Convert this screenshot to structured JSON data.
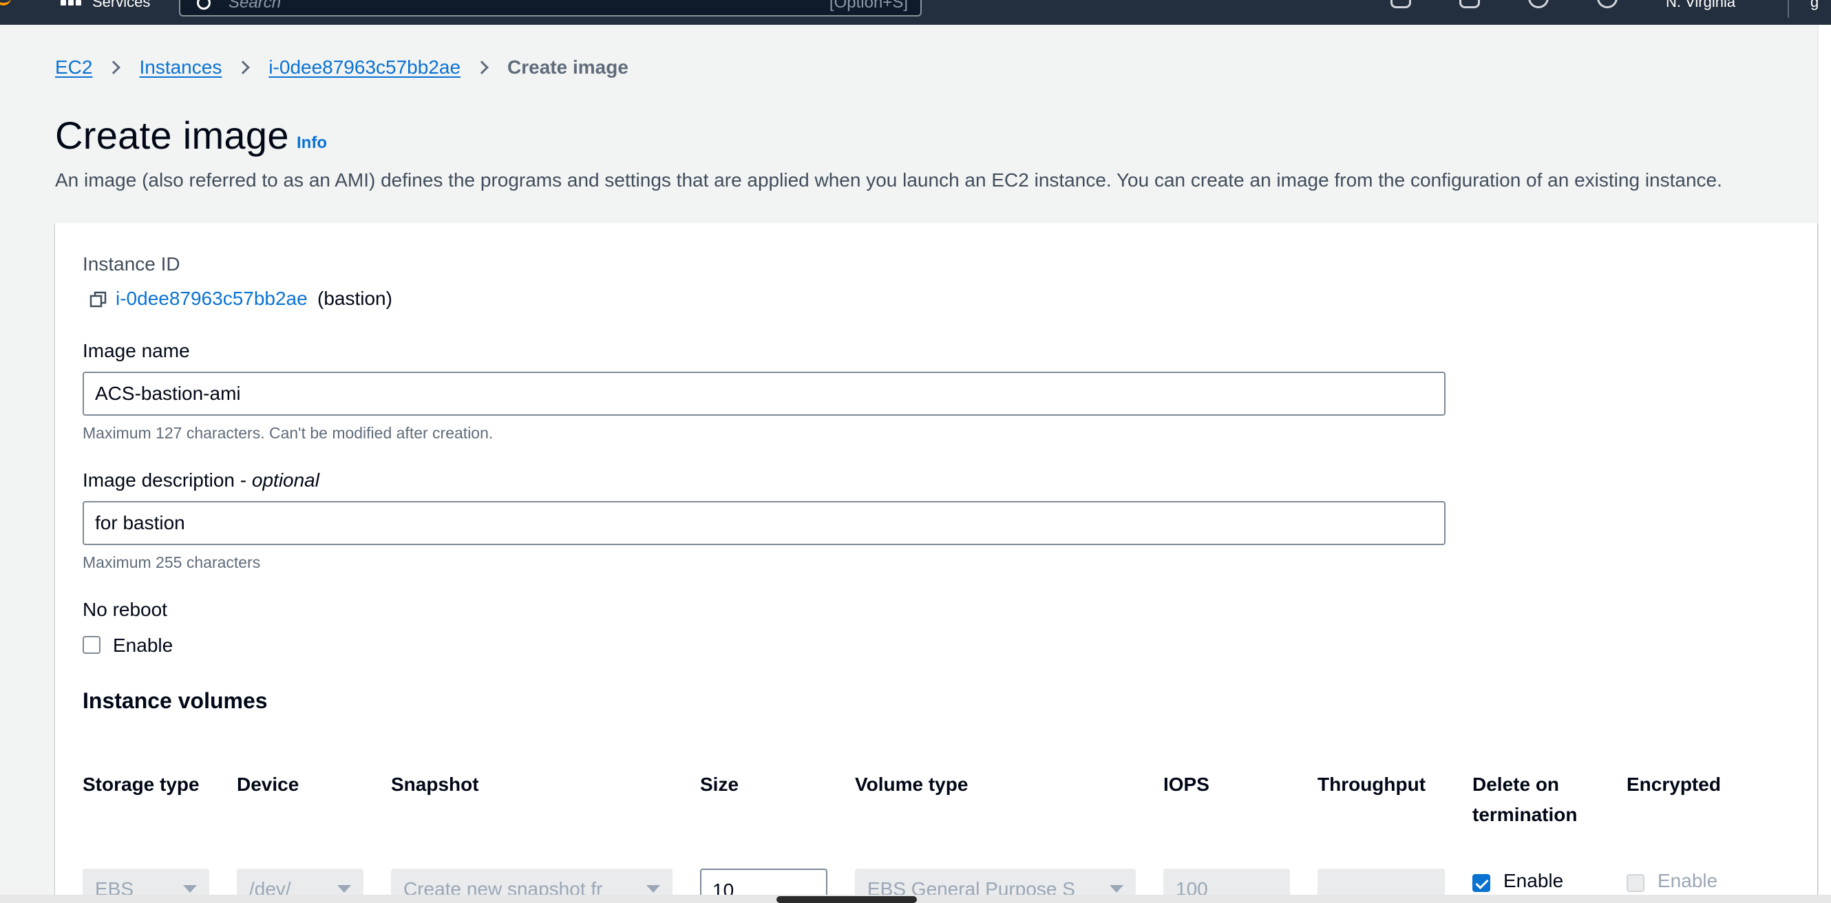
{
  "topnav": {
    "services_label": "Services",
    "search_placeholder": "Search",
    "search_shortcut": "[Option+S]",
    "region": "N. Virginia",
    "account_fragment": "g"
  },
  "breadcrumb": {
    "items": [
      "EC2",
      "Instances",
      "i-0dee87963c57bb2ae"
    ],
    "current": "Create image"
  },
  "page": {
    "title": "Create image",
    "info": "Info",
    "description": "An image (also referred to as an AMI) defines the programs and settings that are applied when you launch an EC2 instance. You can create an image from the configuration of an existing instance."
  },
  "form": {
    "instance_id_label": "Instance ID",
    "instance_id": "i-0dee87963c57bb2ae",
    "instance_name": "(bastion)",
    "image_name_label": "Image name",
    "image_name_value": "ACS-bastion-ami",
    "image_name_hint": "Maximum 127 characters. Can't be modified after creation.",
    "image_desc_label": "Image description - ",
    "image_desc_optional": "optional",
    "image_desc_value": "for bastion",
    "image_desc_hint": "Maximum 255 characters",
    "no_reboot_label": "No reboot",
    "no_reboot_checkbox_label": "Enable",
    "no_reboot_checked": false
  },
  "volumes": {
    "title": "Instance volumes",
    "columns": [
      "Storage type",
      "Device",
      "Snapshot",
      "Size",
      "Volume type",
      "IOPS",
      "Throughput",
      "Delete on",
      "termination",
      "Encrypted"
    ],
    "row": {
      "storage_type": "EBS",
      "device": "/dev/",
      "snapshot": "Create new snapshot fr",
      "size": "10",
      "volume_type": "EBS General Purpose S",
      "iops": "100",
      "throughput": "",
      "delete_on_termination_label": "Enable",
      "delete_on_termination_checked": true,
      "encrypted_label": "Enable",
      "encrypted_checked": false
    }
  },
  "colors": {
    "link": "#0972d3",
    "nav_bg": "#232f3e",
    "page_bg": "#f2f3f3",
    "accent_orange": "#ff9900"
  }
}
